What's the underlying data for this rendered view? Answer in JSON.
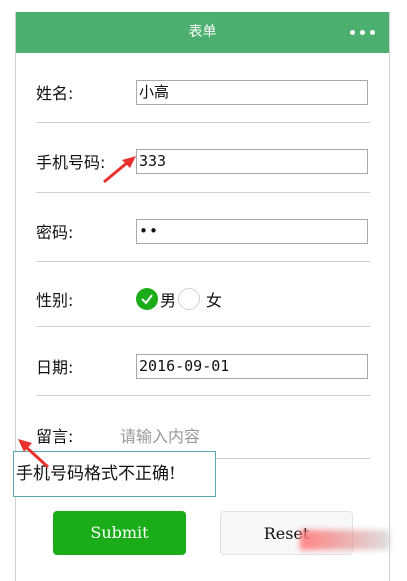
{
  "nav": {
    "title": "表单"
  },
  "form": {
    "name_label": "姓名:",
    "name_value": "小高",
    "phone_label": "手机号码:",
    "phone_value": "333",
    "password_label": "密码:",
    "password_value": "••",
    "gender_label": "性别:",
    "gender_options": [
      "男",
      "女"
    ],
    "gender_selected": "男",
    "date_label": "日期:",
    "date_value": "2016-09-01",
    "message_label": "留言:",
    "message_placeholder": "请输入内容"
  },
  "error": {
    "text": "手机号码格式不正确!"
  },
  "buttons": {
    "submit": "Submit",
    "reset": "Reset"
  },
  "colors": {
    "nav": "#4caf6f",
    "primary": "#1aad19",
    "annotation": "#e8322e"
  }
}
